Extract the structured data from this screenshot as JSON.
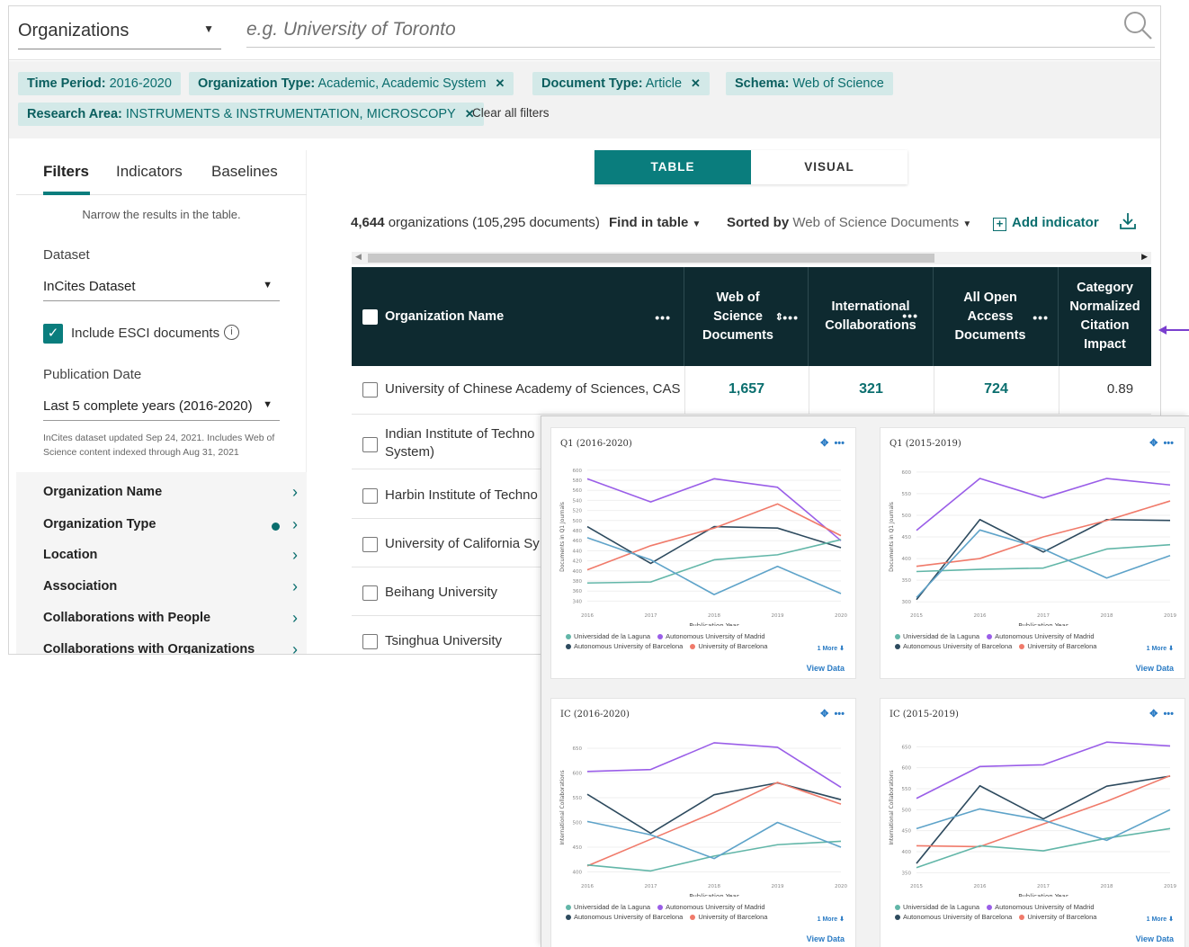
{
  "search": {
    "entity": "Organizations",
    "placeholder": "e.g. University of Toronto"
  },
  "filters": {
    "chips": [
      {
        "key": "Time Period:",
        "value": " 2016-2020",
        "removable": false
      },
      {
        "key": "Organization Type:",
        "value": " Academic, Academic System",
        "removable": true
      },
      {
        "key": "Document Type:",
        "value": " Article",
        "removable": true
      },
      {
        "key": "Schema:",
        "value": " Web of Science",
        "removable": false
      },
      {
        "key": "Research Area:",
        "value": " INSTRUMENTS & INSTRUMENTATION, MICROSCOPY",
        "removable": true
      }
    ],
    "clear_all": "Clear all filters",
    "remove_glyph": "✕"
  },
  "left_panel": {
    "tabs": [
      "Filters",
      "Indicators",
      "Baselines"
    ],
    "narrow_text": "Narrow the results in the table.",
    "dataset_label": "Dataset",
    "dataset_value": "InCites Dataset",
    "esci_label": "Include ESCI documents",
    "pubdate_label": "Publication Date",
    "pubdate_value": "Last 5 complete years (2016-2020)",
    "dataset_note": "InCites dataset updated Sep 24, 2021. Includes Web of Science content indexed through Aug 31, 2021",
    "facets": [
      "Organization Name",
      "Organization Type",
      "Location",
      "Association",
      "Collaborations with People",
      "Collaborations with Organizations"
    ]
  },
  "view_toggle": {
    "table": "TABLE",
    "visual": "VISUAL",
    "active": "TABLE"
  },
  "summary": {
    "org_count": "4,644",
    "org_text": " organizations (105,295 documents)",
    "find": "Find in table",
    "sorted_by_label": "Sorted by",
    "sorted_by_value": " Web of Science Documents",
    "add_indicator": "Add indicator"
  },
  "table": {
    "columns": [
      "Organization Name",
      "Web of Science Documents",
      "International Collaborations",
      "All Open Access Documents",
      "Category Normalized Citation Impact"
    ],
    "rows": [
      {
        "name": "University of Chinese Academy of Sciences, CAS",
        "wos": "1,657",
        "intl": "321",
        "oa": "724",
        "cnci": "0.89"
      },
      {
        "name": "Indian Institute of Technology System (IIT System)",
        "name_visible": "Indian Institute of Techno",
        "name_line2": "System)"
      },
      {
        "name_visible": "Harbin Institute of Techno"
      },
      {
        "name_visible": "University of California Sy"
      },
      {
        "name_visible": "Beihang University"
      },
      {
        "name_visible": "Tsinghua University"
      }
    ]
  },
  "visual": {
    "view_data": "View Data",
    "more": "1 More ⬇",
    "x_title": "Publication Year",
    "legend": [
      {
        "name": "Universidad de la Laguna",
        "color": "#62b6a8"
      },
      {
        "name": "Autonomous University of Madrid",
        "color": "#9a5ee8"
      },
      {
        "name": "Autonomous University of Barcelona",
        "color": "#2d4a5e"
      },
      {
        "name": "University of Barcelona",
        "color": "#f07a6a"
      }
    ],
    "cards": [
      {
        "title": "Q1 (2016-2020)",
        "ylabel": "Documents in Q1 Journals",
        "x": [
          "2016",
          "2017",
          "2018",
          "2019",
          "2020"
        ],
        "yticks": [
          340,
          360,
          380,
          400,
          420,
          440,
          460,
          480,
          500,
          520,
          540,
          560,
          580,
          600
        ],
        "ylim": [
          330,
          605
        ],
        "series": [
          {
            "color": "#9a5ee8",
            "values": [
              583,
              537,
              583,
              566,
              460
            ]
          },
          {
            "color": "#2d4a5e",
            "values": [
              488,
              415,
              488,
              485,
              446
            ]
          },
          {
            "color": "#f07a6a",
            "values": [
              402,
              450,
              485,
              533,
              470
            ]
          },
          {
            "color": "#62b6a8",
            "values": [
              376,
              378,
              422,
              432,
              462
            ]
          },
          {
            "color": "#5ea3c9",
            "values": [
              466,
              422,
              353,
              409,
              355
            ]
          }
        ]
      },
      {
        "title": "Q1 (2015-2019)",
        "ylabel": "Documents in Q1 Journals",
        "x": [
          "2015",
          "2016",
          "2017",
          "2018",
          "2019"
        ],
        "yticks": [
          300,
          350,
          400,
          450,
          500,
          550,
          600
        ],
        "ylim": [
          290,
          610
        ],
        "series": [
          {
            "color": "#9a5ee8",
            "values": [
              465,
              585,
              540,
              585,
              570
            ]
          },
          {
            "color": "#2d4a5e",
            "values": [
              305,
              490,
              415,
              490,
              488
            ]
          },
          {
            "color": "#f07a6a",
            "values": [
              382,
              400,
              450,
              488,
              533
            ]
          },
          {
            "color": "#62b6a8",
            "values": [
              370,
              375,
              378,
              422,
              432
            ]
          },
          {
            "color": "#5ea3c9",
            "values": [
              310,
              466,
              422,
              355,
              407
            ]
          }
        ]
      },
      {
        "title": "IC (2016-2020)",
        "ylabel": "International Collaborations",
        "x": [
          "2016",
          "2017",
          "2018",
          "2019",
          "2020"
        ],
        "yticks": [
          400,
          450,
          500,
          550,
          600,
          650
        ],
        "ylim": [
          390,
          670
        ],
        "series": [
          {
            "color": "#9a5ee8",
            "values": [
              603,
              607,
              661,
              652,
              571
            ]
          },
          {
            "color": "#2d4a5e",
            "values": [
              557,
              478,
              556,
              580,
              546
            ]
          },
          {
            "color": "#f07a6a",
            "values": [
              412,
              466,
              520,
              581,
              537
            ]
          },
          {
            "color": "#62b6a8",
            "values": [
              414,
              402,
              432,
              455,
              462
            ]
          },
          {
            "color": "#5ea3c9",
            "values": [
              502,
              475,
              427,
              500,
              450
            ]
          }
        ]
      },
      {
        "title": "IC (2015-2019)",
        "ylabel": "International Collaborations",
        "x": [
          "2015",
          "2016",
          "2017",
          "2018",
          "2019"
        ],
        "yticks": [
          350,
          400,
          450,
          500,
          550,
          600,
          650
        ],
        "ylim": [
          340,
          670
        ],
        "series": [
          {
            "color": "#9a5ee8",
            "values": [
              527,
              603,
              607,
              661,
              652
            ]
          },
          {
            "color": "#2d4a5e",
            "values": [
              372,
              557,
              478,
              556,
              580
            ]
          },
          {
            "color": "#f07a6a",
            "values": [
              414,
              412,
              466,
              520,
              581
            ]
          },
          {
            "color": "#62b6a8",
            "values": [
              362,
              414,
              402,
              432,
              455
            ]
          },
          {
            "color": "#5ea3c9",
            "values": [
              455,
              502,
              475,
              427,
              500
            ]
          }
        ]
      }
    ]
  },
  "colors": {
    "accent": "#0a7d7d",
    "table_header": "#0e2a30",
    "annotation_arrow": "#7a3fcf"
  }
}
